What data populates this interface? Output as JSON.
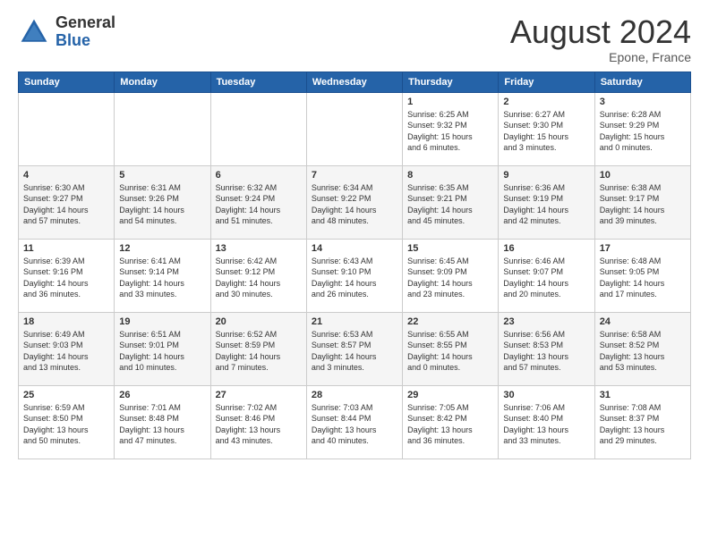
{
  "logo": {
    "general": "General",
    "blue": "Blue"
  },
  "title": "August 2024",
  "location": "Epone, France",
  "days_of_week": [
    "Sunday",
    "Monday",
    "Tuesday",
    "Wednesday",
    "Thursday",
    "Friday",
    "Saturday"
  ],
  "weeks": [
    [
      {
        "day": "",
        "info": ""
      },
      {
        "day": "",
        "info": ""
      },
      {
        "day": "",
        "info": ""
      },
      {
        "day": "",
        "info": ""
      },
      {
        "day": "1",
        "info": "Sunrise: 6:25 AM\nSunset: 9:32 PM\nDaylight: 15 hours\nand 6 minutes."
      },
      {
        "day": "2",
        "info": "Sunrise: 6:27 AM\nSunset: 9:30 PM\nDaylight: 15 hours\nand 3 minutes."
      },
      {
        "day": "3",
        "info": "Sunrise: 6:28 AM\nSunset: 9:29 PM\nDaylight: 15 hours\nand 0 minutes."
      }
    ],
    [
      {
        "day": "4",
        "info": "Sunrise: 6:30 AM\nSunset: 9:27 PM\nDaylight: 14 hours\nand 57 minutes."
      },
      {
        "day": "5",
        "info": "Sunrise: 6:31 AM\nSunset: 9:26 PM\nDaylight: 14 hours\nand 54 minutes."
      },
      {
        "day": "6",
        "info": "Sunrise: 6:32 AM\nSunset: 9:24 PM\nDaylight: 14 hours\nand 51 minutes."
      },
      {
        "day": "7",
        "info": "Sunrise: 6:34 AM\nSunset: 9:22 PM\nDaylight: 14 hours\nand 48 minutes."
      },
      {
        "day": "8",
        "info": "Sunrise: 6:35 AM\nSunset: 9:21 PM\nDaylight: 14 hours\nand 45 minutes."
      },
      {
        "day": "9",
        "info": "Sunrise: 6:36 AM\nSunset: 9:19 PM\nDaylight: 14 hours\nand 42 minutes."
      },
      {
        "day": "10",
        "info": "Sunrise: 6:38 AM\nSunset: 9:17 PM\nDaylight: 14 hours\nand 39 minutes."
      }
    ],
    [
      {
        "day": "11",
        "info": "Sunrise: 6:39 AM\nSunset: 9:16 PM\nDaylight: 14 hours\nand 36 minutes."
      },
      {
        "day": "12",
        "info": "Sunrise: 6:41 AM\nSunset: 9:14 PM\nDaylight: 14 hours\nand 33 minutes."
      },
      {
        "day": "13",
        "info": "Sunrise: 6:42 AM\nSunset: 9:12 PM\nDaylight: 14 hours\nand 30 minutes."
      },
      {
        "day": "14",
        "info": "Sunrise: 6:43 AM\nSunset: 9:10 PM\nDaylight: 14 hours\nand 26 minutes."
      },
      {
        "day": "15",
        "info": "Sunrise: 6:45 AM\nSunset: 9:09 PM\nDaylight: 14 hours\nand 23 minutes."
      },
      {
        "day": "16",
        "info": "Sunrise: 6:46 AM\nSunset: 9:07 PM\nDaylight: 14 hours\nand 20 minutes."
      },
      {
        "day": "17",
        "info": "Sunrise: 6:48 AM\nSunset: 9:05 PM\nDaylight: 14 hours\nand 17 minutes."
      }
    ],
    [
      {
        "day": "18",
        "info": "Sunrise: 6:49 AM\nSunset: 9:03 PM\nDaylight: 14 hours\nand 13 minutes."
      },
      {
        "day": "19",
        "info": "Sunrise: 6:51 AM\nSunset: 9:01 PM\nDaylight: 14 hours\nand 10 minutes."
      },
      {
        "day": "20",
        "info": "Sunrise: 6:52 AM\nSunset: 8:59 PM\nDaylight: 14 hours\nand 7 minutes."
      },
      {
        "day": "21",
        "info": "Sunrise: 6:53 AM\nSunset: 8:57 PM\nDaylight: 14 hours\nand 3 minutes."
      },
      {
        "day": "22",
        "info": "Sunrise: 6:55 AM\nSunset: 8:55 PM\nDaylight: 14 hours\nand 0 minutes."
      },
      {
        "day": "23",
        "info": "Sunrise: 6:56 AM\nSunset: 8:53 PM\nDaylight: 13 hours\nand 57 minutes."
      },
      {
        "day": "24",
        "info": "Sunrise: 6:58 AM\nSunset: 8:52 PM\nDaylight: 13 hours\nand 53 minutes."
      }
    ],
    [
      {
        "day": "25",
        "info": "Sunrise: 6:59 AM\nSunset: 8:50 PM\nDaylight: 13 hours\nand 50 minutes."
      },
      {
        "day": "26",
        "info": "Sunrise: 7:01 AM\nSunset: 8:48 PM\nDaylight: 13 hours\nand 47 minutes."
      },
      {
        "day": "27",
        "info": "Sunrise: 7:02 AM\nSunset: 8:46 PM\nDaylight: 13 hours\nand 43 minutes."
      },
      {
        "day": "28",
        "info": "Sunrise: 7:03 AM\nSunset: 8:44 PM\nDaylight: 13 hours\nand 40 minutes."
      },
      {
        "day": "29",
        "info": "Sunrise: 7:05 AM\nSunset: 8:42 PM\nDaylight: 13 hours\nand 36 minutes."
      },
      {
        "day": "30",
        "info": "Sunrise: 7:06 AM\nSunset: 8:40 PM\nDaylight: 13 hours\nand 33 minutes."
      },
      {
        "day": "31",
        "info": "Sunrise: 7:08 AM\nSunset: 8:37 PM\nDaylight: 13 hours\nand 29 minutes."
      }
    ]
  ]
}
